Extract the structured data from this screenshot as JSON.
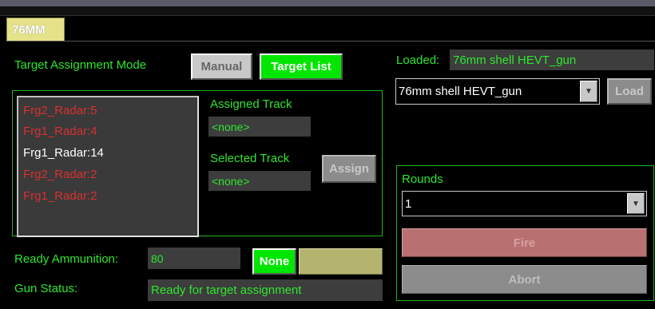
{
  "tab": {
    "label": "76MM"
  },
  "mode": {
    "label": "Target Assignment Mode",
    "manual_label": "Manual",
    "target_list_label": "Target List"
  },
  "tracks": {
    "items": [
      {
        "label": "Frg2_Radar:5",
        "color": "#d73030"
      },
      {
        "label": "Frg1_Radar:4",
        "color": "#d73030"
      },
      {
        "label": "Frg1_Radar:14",
        "color": "#ffffff"
      },
      {
        "label": "Frg2_Radar:2",
        "color": "#d73030"
      },
      {
        "label": "Frg1_Radar:2",
        "color": "#d73030"
      }
    ],
    "assigned_label": "Assigned Track",
    "assigned_value": "<none>",
    "selected_label": "Selected Track",
    "selected_value": "<none>",
    "assign_label": "Assign"
  },
  "ammo": {
    "label": "Ready Ammunition:",
    "value": "80",
    "none_label": "None"
  },
  "gun_status": {
    "label": "Gun Status:",
    "value": "Ready for target assignment"
  },
  "loaded": {
    "label": "Loaded:",
    "value": "76mm shell HEVT_gun",
    "selected_option": "76mm shell HEVT_gun",
    "load_label": "Load"
  },
  "rounds": {
    "label": "Rounds",
    "selected": "1",
    "fire_label": "Fire",
    "abort_label": "Abort"
  },
  "colors": {
    "accent_green": "#2ee62e",
    "button_green": "#00e600",
    "tab_yellow": "#e6e28a",
    "alert_red": "#d73030"
  }
}
